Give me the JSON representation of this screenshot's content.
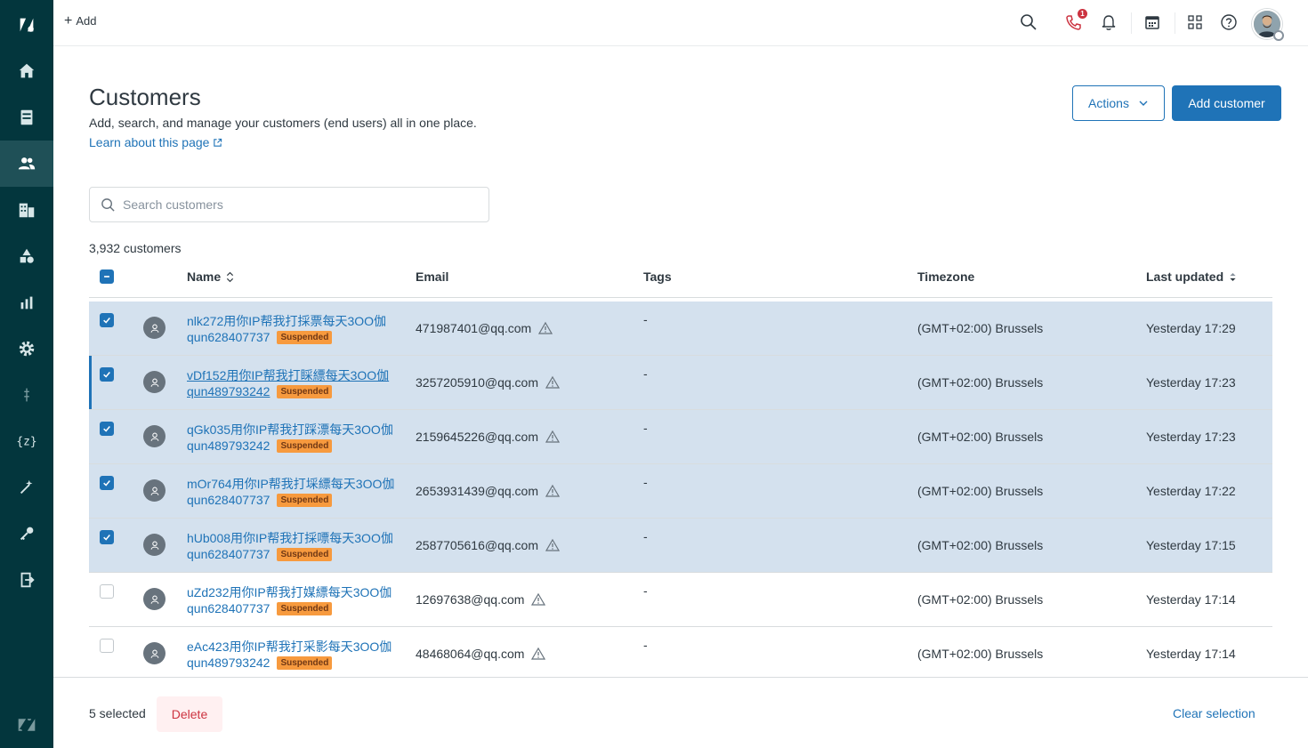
{
  "topbar": {
    "add_label": "Add",
    "notification_count": "1"
  },
  "header": {
    "title": "Customers",
    "subtitle": "Add, search, and manage your customers (end users) all in one place.",
    "learn_link": "Learn about this page",
    "actions_label": "Actions",
    "add_customer_label": "Add customer"
  },
  "search": {
    "placeholder": "Search customers",
    "value": ""
  },
  "count_label": "3,932 customers",
  "table": {
    "columns": {
      "name": "Name",
      "email": "Email",
      "tags": "Tags",
      "timezone": "Timezone",
      "last_updated": "Last updated"
    },
    "rows": [
      {
        "name": "nlk272用你IP帮我打採票每天3OO伽",
        "group": "qun628407737",
        "badge": "Suspended",
        "email": "471987401@qq.com",
        "tags": "-",
        "timezone": "(GMT+02:00) Brussels",
        "updated": "Yesterday 17:29",
        "checked": true
      },
      {
        "name": "vDf152用你IP帮我打睬縹每天3OO伽",
        "group": "qun489793242",
        "badge": "Suspended",
        "email": "3257205910@qq.com",
        "tags": "-",
        "timezone": "(GMT+02:00) Brussels",
        "updated": "Yesterday 17:23",
        "checked": true
      },
      {
        "name": "qGk035用你IP帮我打踩漂每天3OO伽",
        "group": "qun489793242",
        "badge": "Suspended",
        "email": "2159645226@qq.com",
        "tags": "-",
        "timezone": "(GMT+02:00) Brussels",
        "updated": "Yesterday 17:23",
        "checked": true
      },
      {
        "name": "mOr764用你IP帮我打埰縹每天3OO伽",
        "group": "qun628407737",
        "badge": "Suspended",
        "email": "2653931439@qq.com",
        "tags": "-",
        "timezone": "(GMT+02:00) Brussels",
        "updated": "Yesterday 17:22",
        "checked": true
      },
      {
        "name": "hUb008用你IP帮我打採嘌每天3OO伽",
        "group": "qun628407737",
        "badge": "Suspended",
        "email": "2587705616@qq.com",
        "tags": "-",
        "timezone": "(GMT+02:00) Brussels",
        "updated": "Yesterday 17:15",
        "checked": true
      },
      {
        "name": "uZd232用你IP帮我打媒縹每天3OO伽",
        "group": "qun628407737",
        "badge": "Suspended",
        "email": "12697638@qq.com",
        "tags": "-",
        "timezone": "(GMT+02:00) Brussels",
        "updated": "Yesterday 17:14",
        "checked": false
      },
      {
        "name": "eAc423用你IP帮我打采影每天3OO伽",
        "group": "qun489793242",
        "badge": "Suspended",
        "email": "48468064@qq.com",
        "tags": "-",
        "timezone": "(GMT+02:00) Brussels",
        "updated": "Yesterday 17:14",
        "checked": false
      }
    ]
  },
  "bottom": {
    "selected_label": "5 selected",
    "delete_label": "Delete",
    "clear_label": "Clear selection"
  },
  "colors": {
    "sidebar": "#03363d",
    "accent": "#1f73b7",
    "selected_row": "#d4e1ee",
    "badge": "#f79a3e"
  }
}
